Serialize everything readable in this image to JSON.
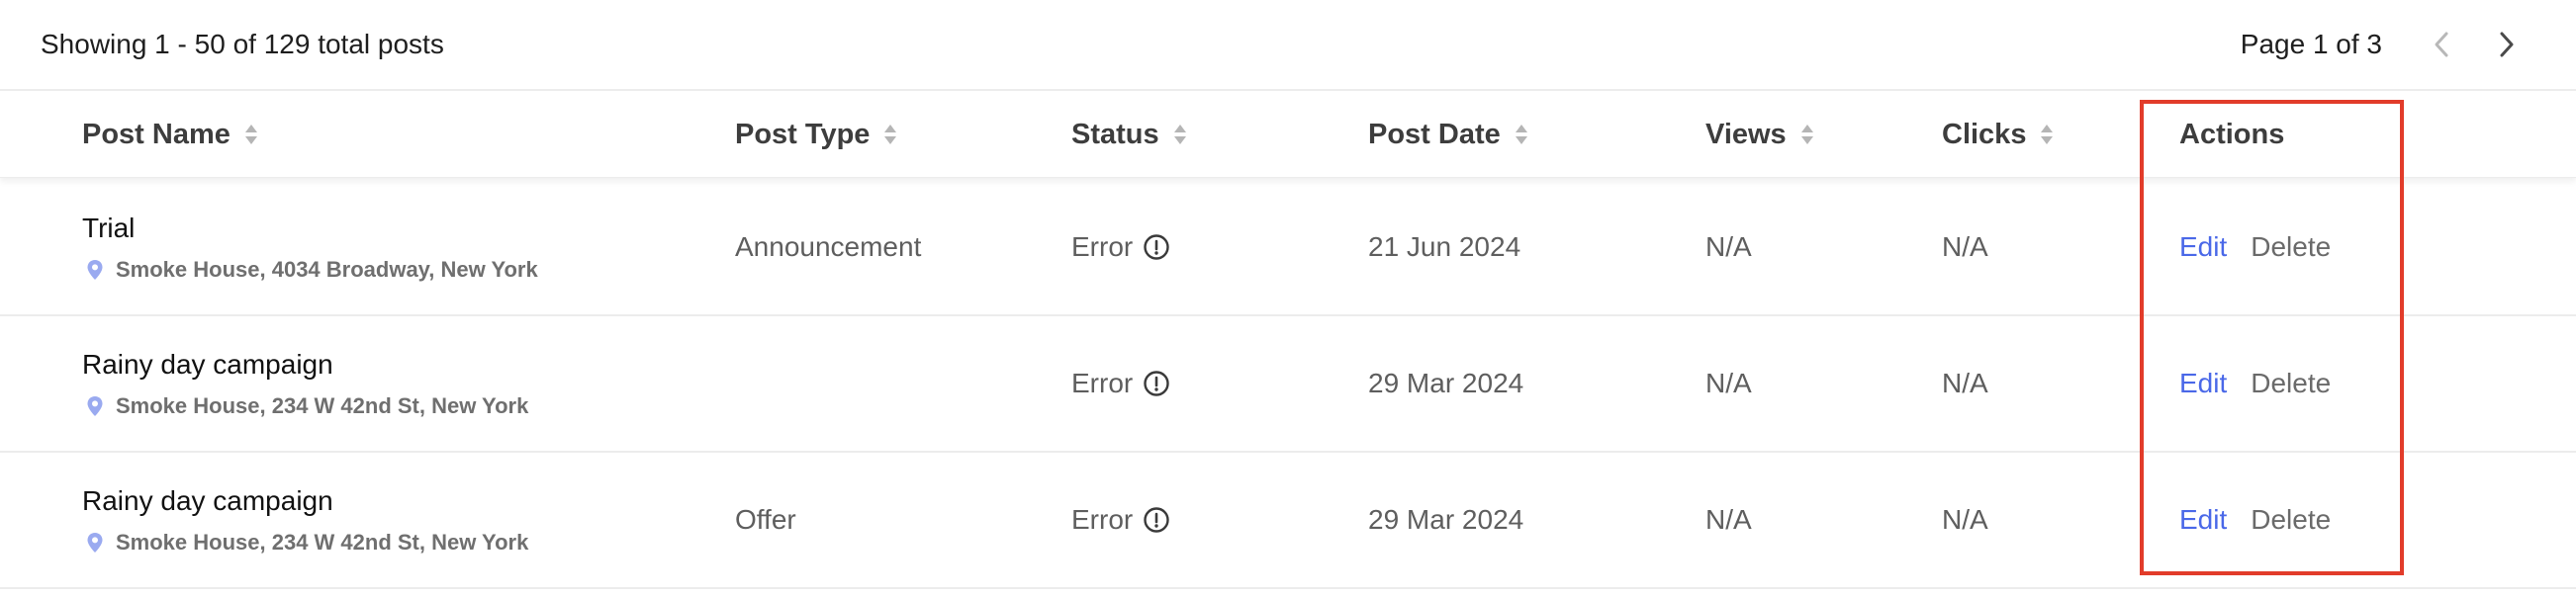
{
  "summary": {
    "showing_text": "Showing 1 - 50 of 129 total posts"
  },
  "pagination": {
    "label": "Page 1 of 3",
    "prev_icon": "chevron-left-icon",
    "next_icon": "chevron-right-icon"
  },
  "columns": {
    "post_name": "Post Name",
    "post_type": "Post Type",
    "status": "Status",
    "post_date": "Post Date",
    "views": "Views",
    "clicks": "Clicks",
    "actions": "Actions"
  },
  "rows": [
    {
      "name": "Trial",
      "location": "Smoke House, 4034 Broadway, New York",
      "type": "Announcement",
      "status": "Error",
      "date": "21 Jun 2024",
      "views": "N/A",
      "clicks": "N/A",
      "edit": "Edit",
      "delete": "Delete"
    },
    {
      "name": "Rainy day campaign",
      "location": "Smoke House, 234 W 42nd St, New York",
      "type": "",
      "status": "Error",
      "date": "29 Mar 2024",
      "views": "N/A",
      "clicks": "N/A",
      "edit": "Edit",
      "delete": "Delete"
    },
    {
      "name": "Rainy day campaign",
      "location": "Smoke House, 234 W 42nd St, New York",
      "type": "Offer",
      "status": "Error",
      "date": "29 Mar 2024",
      "views": "N/A",
      "clicks": "N/A",
      "edit": "Edit",
      "delete": "Delete"
    }
  ],
  "colors": {
    "edit_link": "#4a68e8",
    "highlight_border": "#e23c2a",
    "location_pin": "#9aaaf0"
  }
}
